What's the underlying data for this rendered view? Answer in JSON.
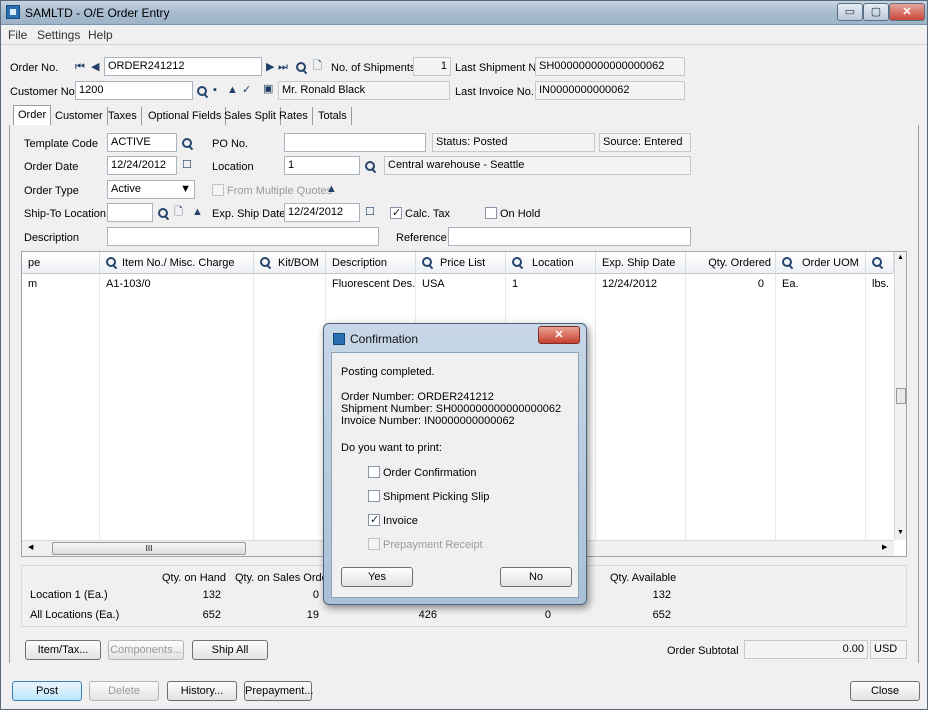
{
  "window": {
    "title": "SAMLTD - O/E Order Entry",
    "controls": [
      "▭",
      "▢",
      "✕"
    ]
  },
  "menu": [
    "File",
    "Settings",
    "Help"
  ],
  "header": {
    "order_no_label": "Order No.",
    "order_no": "ORDER241212",
    "num_shipments_label": "No. of Shipments",
    "num_shipments": "1",
    "last_shipment_label": "Last Shipment No.",
    "last_shipment": "SH000000000000000062",
    "customer_no_label": "Customer No.",
    "customer_no": "1200",
    "customer_name": "Mr. Ronald Black",
    "last_invoice_label": "Last Invoice No.",
    "last_invoice": "IN0000000000062"
  },
  "tabs": [
    "Order",
    "Customer",
    "Taxes",
    "Optional Fields",
    "Sales Split",
    "Rates",
    "Totals"
  ],
  "order_form": {
    "template_code_label": "Template Code",
    "template_code": "ACTIVE",
    "po_no_label": "PO No.",
    "po_no": "",
    "status": "Status: Posted",
    "source": "Source: Entered",
    "order_date_label": "Order Date",
    "order_date": "12/24/2012",
    "location_label": "Location",
    "location": "1",
    "location_desc": "Central warehouse - Seattle",
    "order_type_label": "Order Type",
    "order_type": "Active",
    "from_multiple_quotes": "From Multiple Quotes",
    "ship_to_label": "Ship-To Location",
    "ship_to": "",
    "exp_ship_date_label": "Exp. Ship Date",
    "exp_ship_date": "12/24/2012",
    "calc_tax": "Calc. Tax",
    "on_hold": "On Hold",
    "description_label": "Description",
    "description": "",
    "reference_label": "Reference",
    "reference": ""
  },
  "grid": {
    "columns": [
      "pe",
      "Item No./ Misc. Charge",
      "Kit/BOM",
      "Description",
      "Price List",
      "Location",
      "Exp. Ship Date",
      "Qty. Ordered",
      "Order UOM",
      ""
    ],
    "row": [
      "m",
      "A1-103/0",
      "",
      "Fluorescent Des...",
      "USA",
      "1",
      "12/24/2012",
      "0",
      "Ea.",
      "lbs."
    ],
    "hscroll_thumb": "III"
  },
  "summary": {
    "qty_on_hand": "Qty. on Hand",
    "qty_on_sales_order": "Qty. on Sales Order",
    "qty_available": "Qty. Available",
    "location_row_label": "Location  1 (Ea.)",
    "all_locations_label": "All Locations (Ea.)",
    "loc_on_hand": "132",
    "loc_on_sales": "0",
    "loc_available": "132",
    "all_on_hand": "652",
    "all_on_sales": "19",
    "all_col3": "426",
    "all_col4": "0",
    "all_available": "652"
  },
  "buttons": {
    "item_tax": "Item/Tax...",
    "components": "Components...",
    "ship_all": "Ship All",
    "order_subtotal_label": "Order Subtotal",
    "order_subtotal": "0.00",
    "currency": "USD",
    "post": "Post",
    "delete": "Delete",
    "history": "History...",
    "prepayment": "Prepayment...",
    "close": "Close"
  },
  "dialog": {
    "title": "Confirmation",
    "message": "Posting completed.",
    "order_number": "Order Number: ORDER241212",
    "shipment_number": "Shipment Number: SH000000000000000062",
    "invoice_number": "Invoice Number: IN0000000000062",
    "question": "Do you want to print:",
    "options": [
      {
        "label": "Order Confirmation",
        "checked": false
      },
      {
        "label": "Shipment Picking Slip",
        "checked": false
      },
      {
        "label": "Invoice",
        "checked": true
      },
      {
        "label": "Prepayment Receipt",
        "checked": false,
        "disabled": true
      }
    ],
    "yes": "Yes",
    "no": "No",
    "close": "✕"
  }
}
